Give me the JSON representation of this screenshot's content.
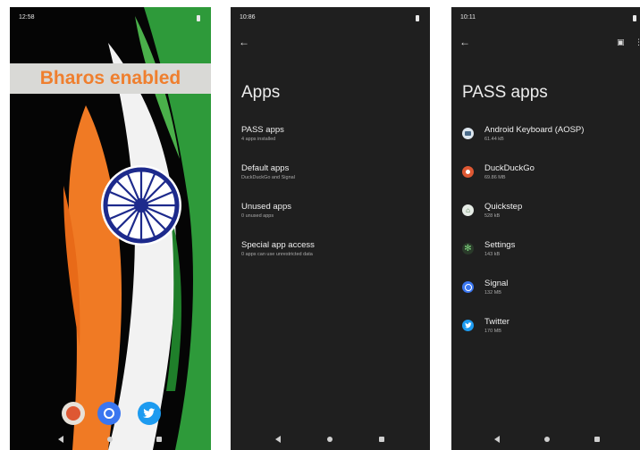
{
  "home": {
    "status_time": "12:58",
    "banner": "Bharos enabled",
    "dock_apps": [
      "duckduckgo-icon",
      "signal-icon",
      "twitter-icon"
    ],
    "colors": {
      "saffron": "#f07a24",
      "white": "#f2f2f2",
      "green": "#2e9a3a",
      "chakra": "#1d2a8c"
    }
  },
  "apps_screen": {
    "status_time": "10:86",
    "title": "Apps",
    "items": [
      {
        "label": "PASS apps",
        "sub": "4 apps installed"
      },
      {
        "label": "Default apps",
        "sub": "DuckDuckGo and Signal"
      },
      {
        "label": "Unused apps",
        "sub": "0 unused apps"
      },
      {
        "label": "Special app access",
        "sub": "0 apps can use unrestricted data"
      }
    ]
  },
  "pass_screen": {
    "status_time": "10:11",
    "title": "PASS apps",
    "apps": [
      {
        "name": "Android Keyboard (AOSP)",
        "size": "61.44 kB",
        "icon": "keyboard-icon"
      },
      {
        "name": "DuckDuckGo",
        "size": "69.86 MB",
        "icon": "duckduckgo-icon"
      },
      {
        "name": "Quickstep",
        "size": "528 kB",
        "icon": "home-icon"
      },
      {
        "name": "Settings",
        "size": "143 kB",
        "icon": "gear-icon"
      },
      {
        "name": "Signal",
        "size": "132 MB",
        "icon": "signal-icon"
      },
      {
        "name": "Twitter",
        "size": "170 MB",
        "icon": "twitter-icon"
      }
    ]
  }
}
